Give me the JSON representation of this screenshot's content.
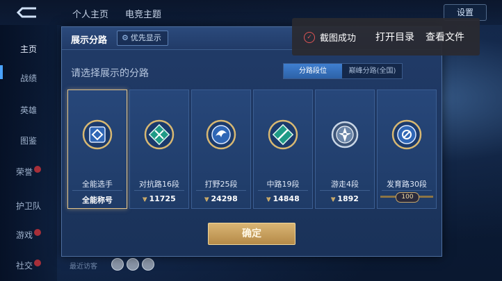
{
  "top": {
    "tabs": [
      "个人主页",
      "电竞主题"
    ],
    "settings_label": "设置"
  },
  "sidebar": {
    "items": [
      {
        "label": "主页",
        "active": true
      },
      {
        "label": "战绩"
      },
      {
        "label": "英雄"
      },
      {
        "label": "图鉴"
      },
      {
        "label": "荣誉",
        "dot": true
      },
      {
        "label": "护卫队"
      },
      {
        "label": "游戏",
        "dot": true
      },
      {
        "label": "社交",
        "dot": true
      }
    ]
  },
  "modal": {
    "title": "展示分路",
    "priority_label": "优先显示",
    "prompt": "请选择展示的分路",
    "seg_on": "分路段位",
    "seg_off": "巅峰分路(全国)",
    "confirm_label": "确定",
    "cards": [
      {
        "name": "全能选手",
        "score": "全能称号",
        "selected": true
      },
      {
        "name": "对抗路16段",
        "score": "11725"
      },
      {
        "name": "打野25段",
        "score": "24298"
      },
      {
        "name": "中路19段",
        "score": "14848"
      },
      {
        "name": "游走4段",
        "score": "1892"
      },
      {
        "name": "发育路30段",
        "rank_plate": "100"
      }
    ]
  },
  "toast": {
    "message": "截图成功",
    "open_dir": "打开目录",
    "view_file": "查看文件"
  },
  "footer": {
    "recent_visitors": "最近访客"
  },
  "colors": {
    "accent_gold": "#d9b574",
    "panel_blue": "#213b68",
    "seg_active": "#3f7fd0"
  }
}
